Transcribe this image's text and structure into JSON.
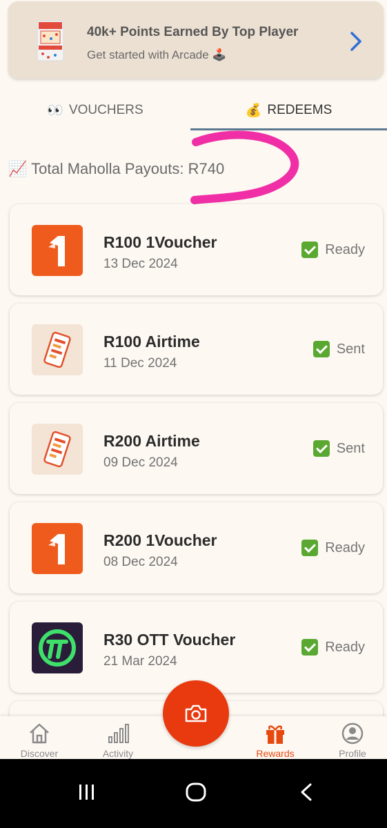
{
  "banner": {
    "title": "40k+ Points Earned By Top Player",
    "subtitle": "Get started with Arcade 🕹️"
  },
  "tabs": [
    {
      "emoji": "👀",
      "label": "VOUCHERS",
      "active": false
    },
    {
      "emoji": "💰",
      "label": "REDEEMS",
      "active": true
    }
  ],
  "payouts": {
    "emoji": "📈",
    "text": "Total Maholla Payouts: R740"
  },
  "redeems": [
    {
      "name": "R100 1Voucher",
      "date": "13 Dec 2024",
      "status": "Ready",
      "logo": "1voucher-logo"
    },
    {
      "name": "R100 Airtime",
      "date": "11 Dec 2024",
      "status": "Sent",
      "logo": "airtime-phone-icon"
    },
    {
      "name": "R200 Airtime",
      "date": "09 Dec 2024",
      "status": "Sent",
      "logo": "airtime-phone-icon"
    },
    {
      "name": "R200 1Voucher",
      "date": "08 Dec 2024",
      "status": "Ready",
      "logo": "1voucher-logo"
    },
    {
      "name": "R30 OTT Voucher",
      "date": "21 Mar 2024",
      "status": "Ready",
      "logo": "ott-logo"
    }
  ],
  "nav": [
    {
      "label": "Discover",
      "icon": "home-icon",
      "active": false
    },
    {
      "label": "Activity",
      "icon": "bar-chart-icon",
      "active": false
    },
    {
      "label": "Rewards",
      "icon": "gift-icon",
      "active": true
    },
    {
      "label": "Profile",
      "icon": "user-icon",
      "active": false
    }
  ],
  "colors": {
    "accent": "#e8390f",
    "ready_check": "#5aa831",
    "tab_underline": "#5b7890",
    "highlight_scribble": "#f02fa6"
  }
}
